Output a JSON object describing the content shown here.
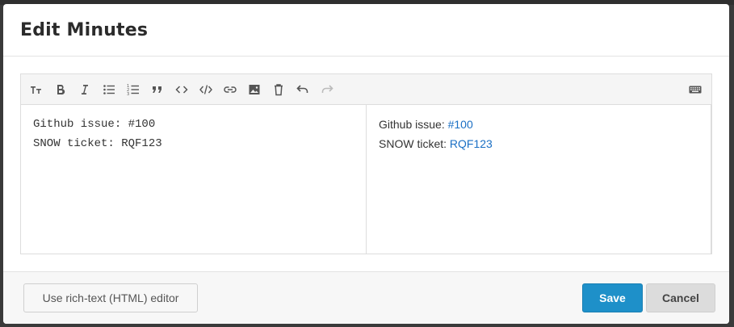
{
  "modal": {
    "title": "Edit Minutes"
  },
  "toolbar": {
    "buttons": [
      {
        "name": "heading-icon",
        "enabled": true
      },
      {
        "name": "bold-icon",
        "enabled": true
      },
      {
        "name": "italic-icon",
        "enabled": true
      },
      {
        "name": "bullet-list-icon",
        "enabled": true
      },
      {
        "name": "numbered-list-icon",
        "enabled": true
      },
      {
        "name": "quote-icon",
        "enabled": true
      },
      {
        "name": "inline-code-icon",
        "enabled": true
      },
      {
        "name": "code-block-icon",
        "enabled": true
      },
      {
        "name": "link-icon",
        "enabled": true
      },
      {
        "name": "image-icon",
        "enabled": true
      },
      {
        "name": "delete-icon",
        "enabled": true
      },
      {
        "name": "undo-icon",
        "enabled": true
      },
      {
        "name": "redo-icon",
        "enabled": false
      },
      {
        "name": "keyboard-icon",
        "enabled": true
      }
    ]
  },
  "editor": {
    "source_lines": [
      "Github issue: #100",
      "SNOW ticket: RQF123"
    ],
    "preview": {
      "line1_prefix": "Github issue: ",
      "line1_link": "#100",
      "line2_prefix": "SNOW ticket: ",
      "line2_link": "RQF123"
    }
  },
  "footer": {
    "rich_text_label": "Use rich-text (HTML) editor",
    "save_label": "Save",
    "cancel_label": "Cancel"
  },
  "colors": {
    "primary": "#1e90c9",
    "link": "#1a6fc4"
  }
}
